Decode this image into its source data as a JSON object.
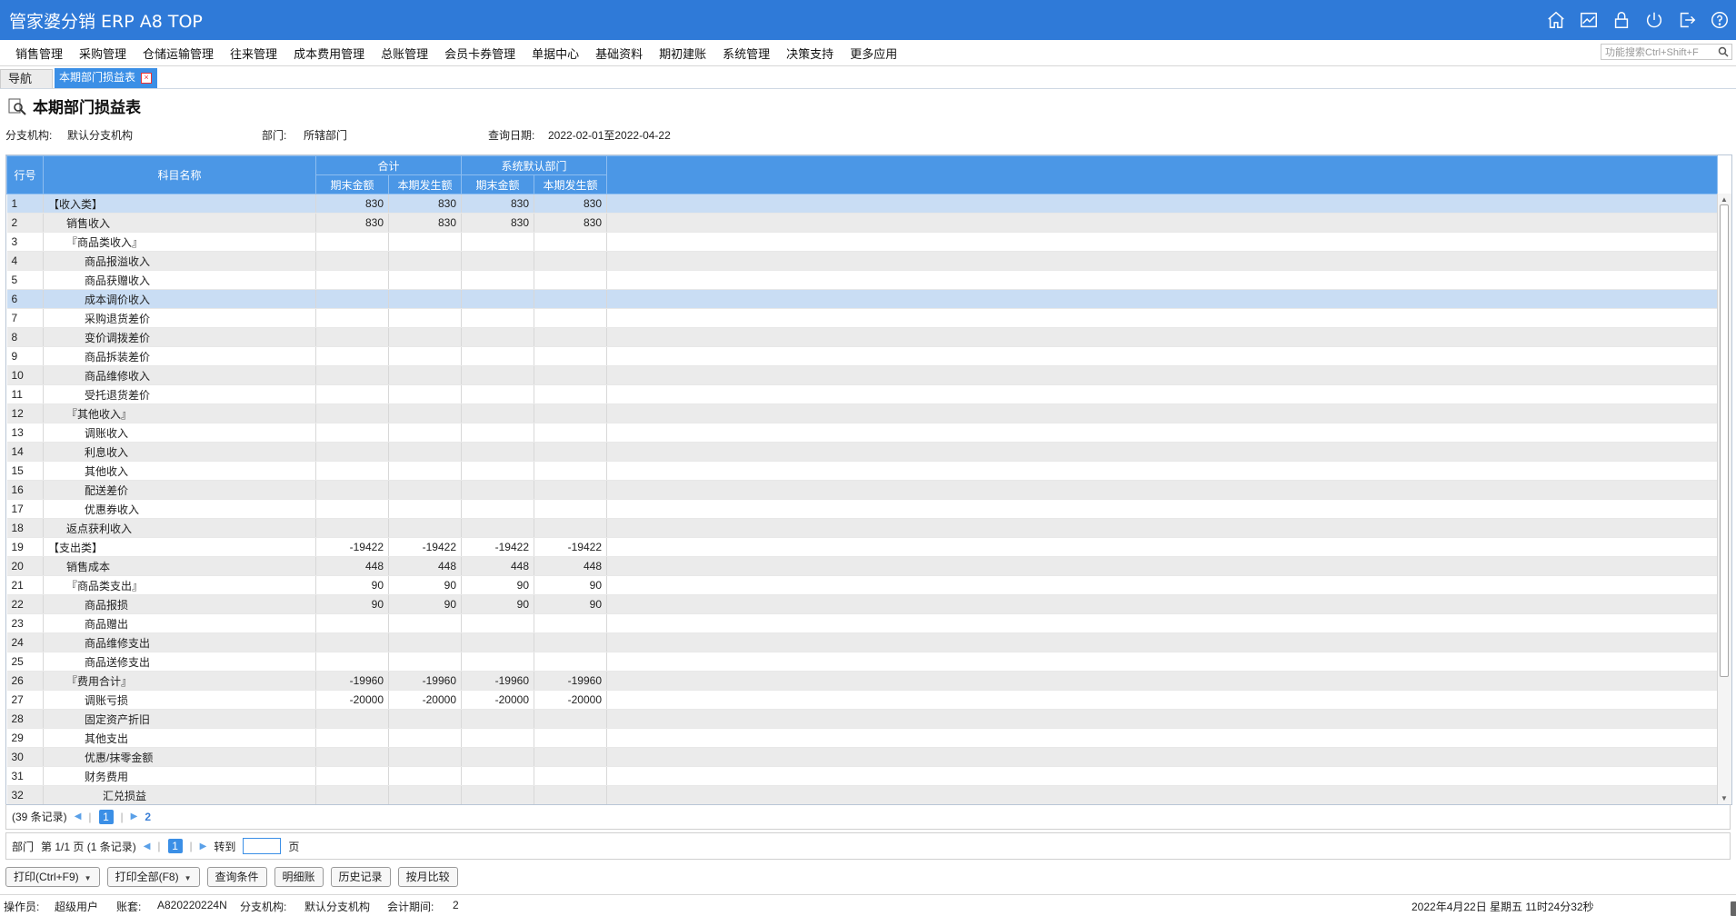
{
  "app": {
    "title": "管家婆分销 ERP A8 TOP"
  },
  "menu": [
    "销售管理",
    "采购管理",
    "仓储运输管理",
    "往来管理",
    "成本费用管理",
    "总账管理",
    "会员卡券管理",
    "单据中心",
    "基础资料",
    "期初建账",
    "系统管理",
    "决策支持",
    "更多应用"
  ],
  "search": {
    "placeholder": "功能搜索Ctrl+Shift+F"
  },
  "tabs": {
    "nav": "导航",
    "active": "本期部门损益表"
  },
  "page": {
    "title": "本期部门损益表"
  },
  "filters": {
    "branch_label": "分支机构:",
    "branch_value": "默认分支机构",
    "dept_label": "部门:",
    "dept_value": "所辖部门",
    "date_label": "查询日期:",
    "date_value": "2022-02-01至2022-04-22"
  },
  "grid": {
    "headers": {
      "row_no": "行号",
      "subject": "科目名称",
      "group_total": "合计",
      "group_default": "系统默认部门",
      "end_amount": "期末金额",
      "period_amount": "本期发生额"
    },
    "rows": [
      {
        "no": "1",
        "name": "【收入类】",
        "indent": 0,
        "v": [
          "830",
          "830",
          "830",
          "830"
        ]
      },
      {
        "no": "2",
        "name": "销售收入",
        "indent": 1,
        "v": [
          "830",
          "830",
          "830",
          "830"
        ]
      },
      {
        "no": "3",
        "name": "『商品类收入』",
        "indent": 1,
        "v": [
          "",
          "",
          "",
          ""
        ]
      },
      {
        "no": "4",
        "name": "商品报溢收入",
        "indent": 2,
        "v": [
          "",
          "",
          "",
          ""
        ]
      },
      {
        "no": "5",
        "name": "商品获赠收入",
        "indent": 2,
        "v": [
          "",
          "",
          "",
          ""
        ]
      },
      {
        "no": "6",
        "name": "成本调价收入",
        "indent": 2,
        "v": [
          "",
          "",
          "",
          ""
        ]
      },
      {
        "no": "7",
        "name": "采购退货差价",
        "indent": 2,
        "v": [
          "",
          "",
          "",
          ""
        ]
      },
      {
        "no": "8",
        "name": "变价调拨差价",
        "indent": 2,
        "v": [
          "",
          "",
          "",
          ""
        ]
      },
      {
        "no": "9",
        "name": "商品拆装差价",
        "indent": 2,
        "v": [
          "",
          "",
          "",
          ""
        ]
      },
      {
        "no": "10",
        "name": "商品维修收入",
        "indent": 2,
        "v": [
          "",
          "",
          "",
          ""
        ]
      },
      {
        "no": "11",
        "name": "受托退货差价",
        "indent": 2,
        "v": [
          "",
          "",
          "",
          ""
        ]
      },
      {
        "no": "12",
        "name": "『其他收入』",
        "indent": 1,
        "v": [
          "",
          "",
          "",
          ""
        ]
      },
      {
        "no": "13",
        "name": "调账收入",
        "indent": 2,
        "v": [
          "",
          "",
          "",
          ""
        ]
      },
      {
        "no": "14",
        "name": "利息收入",
        "indent": 2,
        "v": [
          "",
          "",
          "",
          ""
        ]
      },
      {
        "no": "15",
        "name": "其他收入",
        "indent": 2,
        "v": [
          "",
          "",
          "",
          ""
        ]
      },
      {
        "no": "16",
        "name": "配送差价",
        "indent": 2,
        "v": [
          "",
          "",
          "",
          ""
        ]
      },
      {
        "no": "17",
        "name": "优惠券收入",
        "indent": 2,
        "v": [
          "",
          "",
          "",
          ""
        ]
      },
      {
        "no": "18",
        "name": "返点获利收入",
        "indent": 1,
        "v": [
          "",
          "",
          "",
          ""
        ]
      },
      {
        "no": "19",
        "name": "【支出类】",
        "indent": 0,
        "v": [
          "-19422",
          "-19422",
          "-19422",
          "-19422"
        ]
      },
      {
        "no": "20",
        "name": "销售成本",
        "indent": 1,
        "v": [
          "448",
          "448",
          "448",
          "448"
        ]
      },
      {
        "no": "21",
        "name": "『商品类支出』",
        "indent": 1,
        "v": [
          "90",
          "90",
          "90",
          "90"
        ]
      },
      {
        "no": "22",
        "name": "商品报损",
        "indent": 2,
        "v": [
          "90",
          "90",
          "90",
          "90"
        ]
      },
      {
        "no": "23",
        "name": "商品赠出",
        "indent": 2,
        "v": [
          "",
          "",
          "",
          ""
        ]
      },
      {
        "no": "24",
        "name": "商品维修支出",
        "indent": 2,
        "v": [
          "",
          "",
          "",
          ""
        ]
      },
      {
        "no": "25",
        "name": "商品送修支出",
        "indent": 2,
        "v": [
          "",
          "",
          "",
          ""
        ]
      },
      {
        "no": "26",
        "name": "『费用合计』",
        "indent": 1,
        "v": [
          "-19960",
          "-19960",
          "-19960",
          "-19960"
        ]
      },
      {
        "no": "27",
        "name": "调账亏损",
        "indent": 2,
        "v": [
          "-20000",
          "-20000",
          "-20000",
          "-20000"
        ]
      },
      {
        "no": "28",
        "name": "固定资产折旧",
        "indent": 2,
        "v": [
          "",
          "",
          "",
          ""
        ]
      },
      {
        "no": "29",
        "name": "其他支出",
        "indent": 2,
        "v": [
          "",
          "",
          "",
          ""
        ]
      },
      {
        "no": "30",
        "name": "优惠/抹零金额",
        "indent": 2,
        "v": [
          "",
          "",
          "",
          ""
        ]
      },
      {
        "no": "31",
        "name": "财务费用",
        "indent": 2,
        "v": [
          "",
          "",
          "",
          ""
        ]
      },
      {
        "no": "32",
        "name": "汇兑损益",
        "indent": 3,
        "v": [
          "",
          "",
          "",
          ""
        ]
      }
    ]
  },
  "pager1": {
    "records": "(39 条记录)",
    "page": "1",
    "refresh": "2"
  },
  "pager2": {
    "label": "部门",
    "info": "第 1/1 页 (1 条记录)",
    "page": "1",
    "goto_label": "转到",
    "goto_unit": "页"
  },
  "buttons": {
    "print": "打印(Ctrl+F9)",
    "print_all": "打印全部(F8)",
    "query": "查询条件",
    "detail": "明细账",
    "history": "历史记录",
    "monthly": "按月比较"
  },
  "status": {
    "operator_label": "操作员:",
    "operator": "超级用户",
    "account_label": "账套:",
    "account": "A820220224N",
    "branch_label": "分支机构:",
    "branch": "默认分支机构",
    "period_label": "会计期间:",
    "period": "2",
    "datetime": "2022年4月22日  星期五  11时24分32秒"
  }
}
